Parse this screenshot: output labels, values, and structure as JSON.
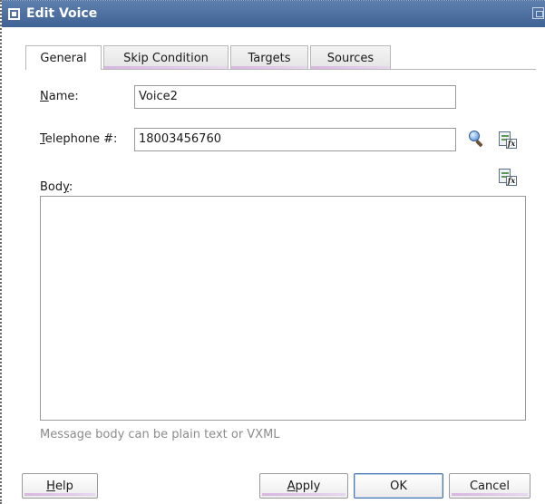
{
  "window": {
    "title": "Edit Voice"
  },
  "tabs": [
    {
      "label": "General",
      "active": true
    },
    {
      "label": "Skip Condition",
      "active": false
    },
    {
      "label": "Targets",
      "active": false
    },
    {
      "label": "Sources",
      "active": false
    }
  ],
  "form": {
    "name": {
      "mnemonic": "N",
      "rest": "ame:",
      "value": "Voice2"
    },
    "telephone": {
      "mnemonic": "T",
      "rest": "elephone #:",
      "value": "18003456760"
    },
    "body": {
      "before": "Bod",
      "mnemonic": "y",
      "after": ":",
      "value": ""
    },
    "hint": "Message body can be plain text or VXML"
  },
  "icons": {
    "search": "search-icon",
    "expression_builder": "expression-builder-icon"
  },
  "buttons": {
    "help": {
      "mnemonic": "H",
      "rest": "elp"
    },
    "apply": {
      "mnemonic": "A",
      "rest": "pply"
    },
    "ok": "OK",
    "cancel": "Cancel"
  },
  "colors": {
    "titlebar": "#4a6ea0",
    "tab_accent": "#d7b6e0",
    "default_button_border": "#4a76b0"
  }
}
